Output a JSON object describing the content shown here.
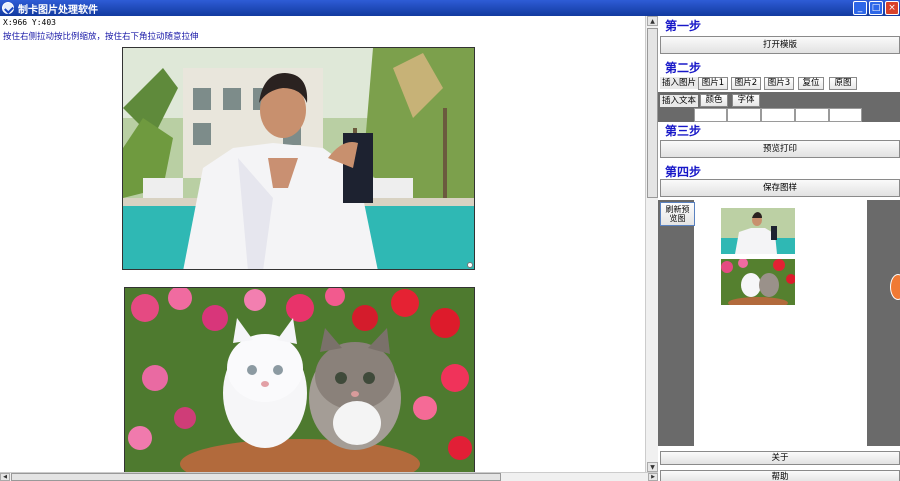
{
  "window": {
    "title": "制卡图片处理软件",
    "controls": [
      "_",
      "□",
      "×"
    ]
  },
  "canvas": {
    "coords_text": "X:966 Y:403",
    "hint_text": "按住右侧拉动按比例缩放，按住右下角拉动随意拉伸",
    "images": [
      {
        "name": "man-pool-photo",
        "description": "man"
      },
      {
        "name": "kittens-flowers-photo",
        "description": "kittens"
      }
    ]
  },
  "panel": {
    "step1": {
      "title": "第一步",
      "button": "打开模版"
    },
    "step2": {
      "title": "第二步",
      "insert_image_label": "插入图片",
      "image_buttons": [
        "图片1",
        "图片2",
        "图片3",
        "复位",
        "原图"
      ],
      "insert_text_label": "插入文本",
      "color_button": "颜色",
      "font_button": "字体"
    },
    "step3": {
      "title": "第三步",
      "button": "预览打印"
    },
    "step4": {
      "title": "第四步",
      "button": "保存图样"
    },
    "preview": {
      "refresh_line1": "刷新预",
      "refresh_line2": "览图"
    },
    "about_button": "关于",
    "help_button": "帮助"
  },
  "colors": {
    "titlebar": "#1f4fc4",
    "step_title": "#1818c8",
    "hint_text": "#1a1aa8",
    "panel_dark": "#6a6a6a"
  }
}
